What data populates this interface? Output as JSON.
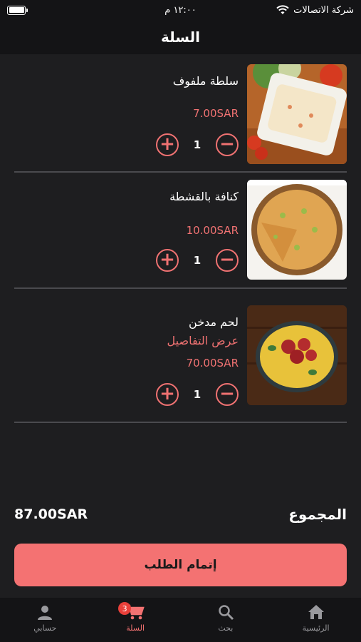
{
  "status": {
    "carrier": "شركة الاتصالات",
    "time": "١٢:٠٠ م"
  },
  "header": {
    "title": "السلة"
  },
  "cart": {
    "items": [
      {
        "name": "سلطة ملفوف",
        "price": "7.00SAR",
        "qty": "1"
      },
      {
        "name": "كنافة بالقشطة",
        "price": "10.00SAR",
        "qty": "1"
      },
      {
        "name": "لحم مدخن",
        "details": "عرض التفاصيل",
        "price": "70.00SAR",
        "qty": "1"
      }
    ]
  },
  "summary": {
    "total_label": "المجموع",
    "total_value": "87.00SAR"
  },
  "checkout": {
    "label": "إتمام الطلب"
  },
  "tabbar": {
    "home": "الرئيسية",
    "search": "بحث",
    "cart": "السلة",
    "cart_badge": "3",
    "account": "حسابي"
  },
  "colors": {
    "accent": "#f47272",
    "background": "#1e1e20",
    "bar": "#141416"
  }
}
